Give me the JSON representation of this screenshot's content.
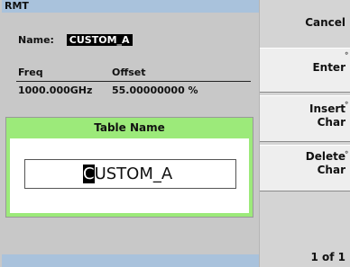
{
  "status": {
    "mode": "RMT"
  },
  "table": {
    "name_label": "Name:",
    "name_value": "CUSTOM_A",
    "columns": [
      "Freq",
      "Offset"
    ],
    "row": [
      "1000.000GHz",
      "55.00000000 %"
    ]
  },
  "dialog": {
    "title": "Table Name",
    "cursor_char": "C",
    "rest_value": "USTOM_A"
  },
  "softkeys": {
    "cancel": "Cancel",
    "enter": "Enter",
    "insert_line1": "Insert",
    "insert_line2": "Char",
    "delete_line1": "Delete",
    "delete_line2": "Char",
    "page": "1 of 1"
  }
}
